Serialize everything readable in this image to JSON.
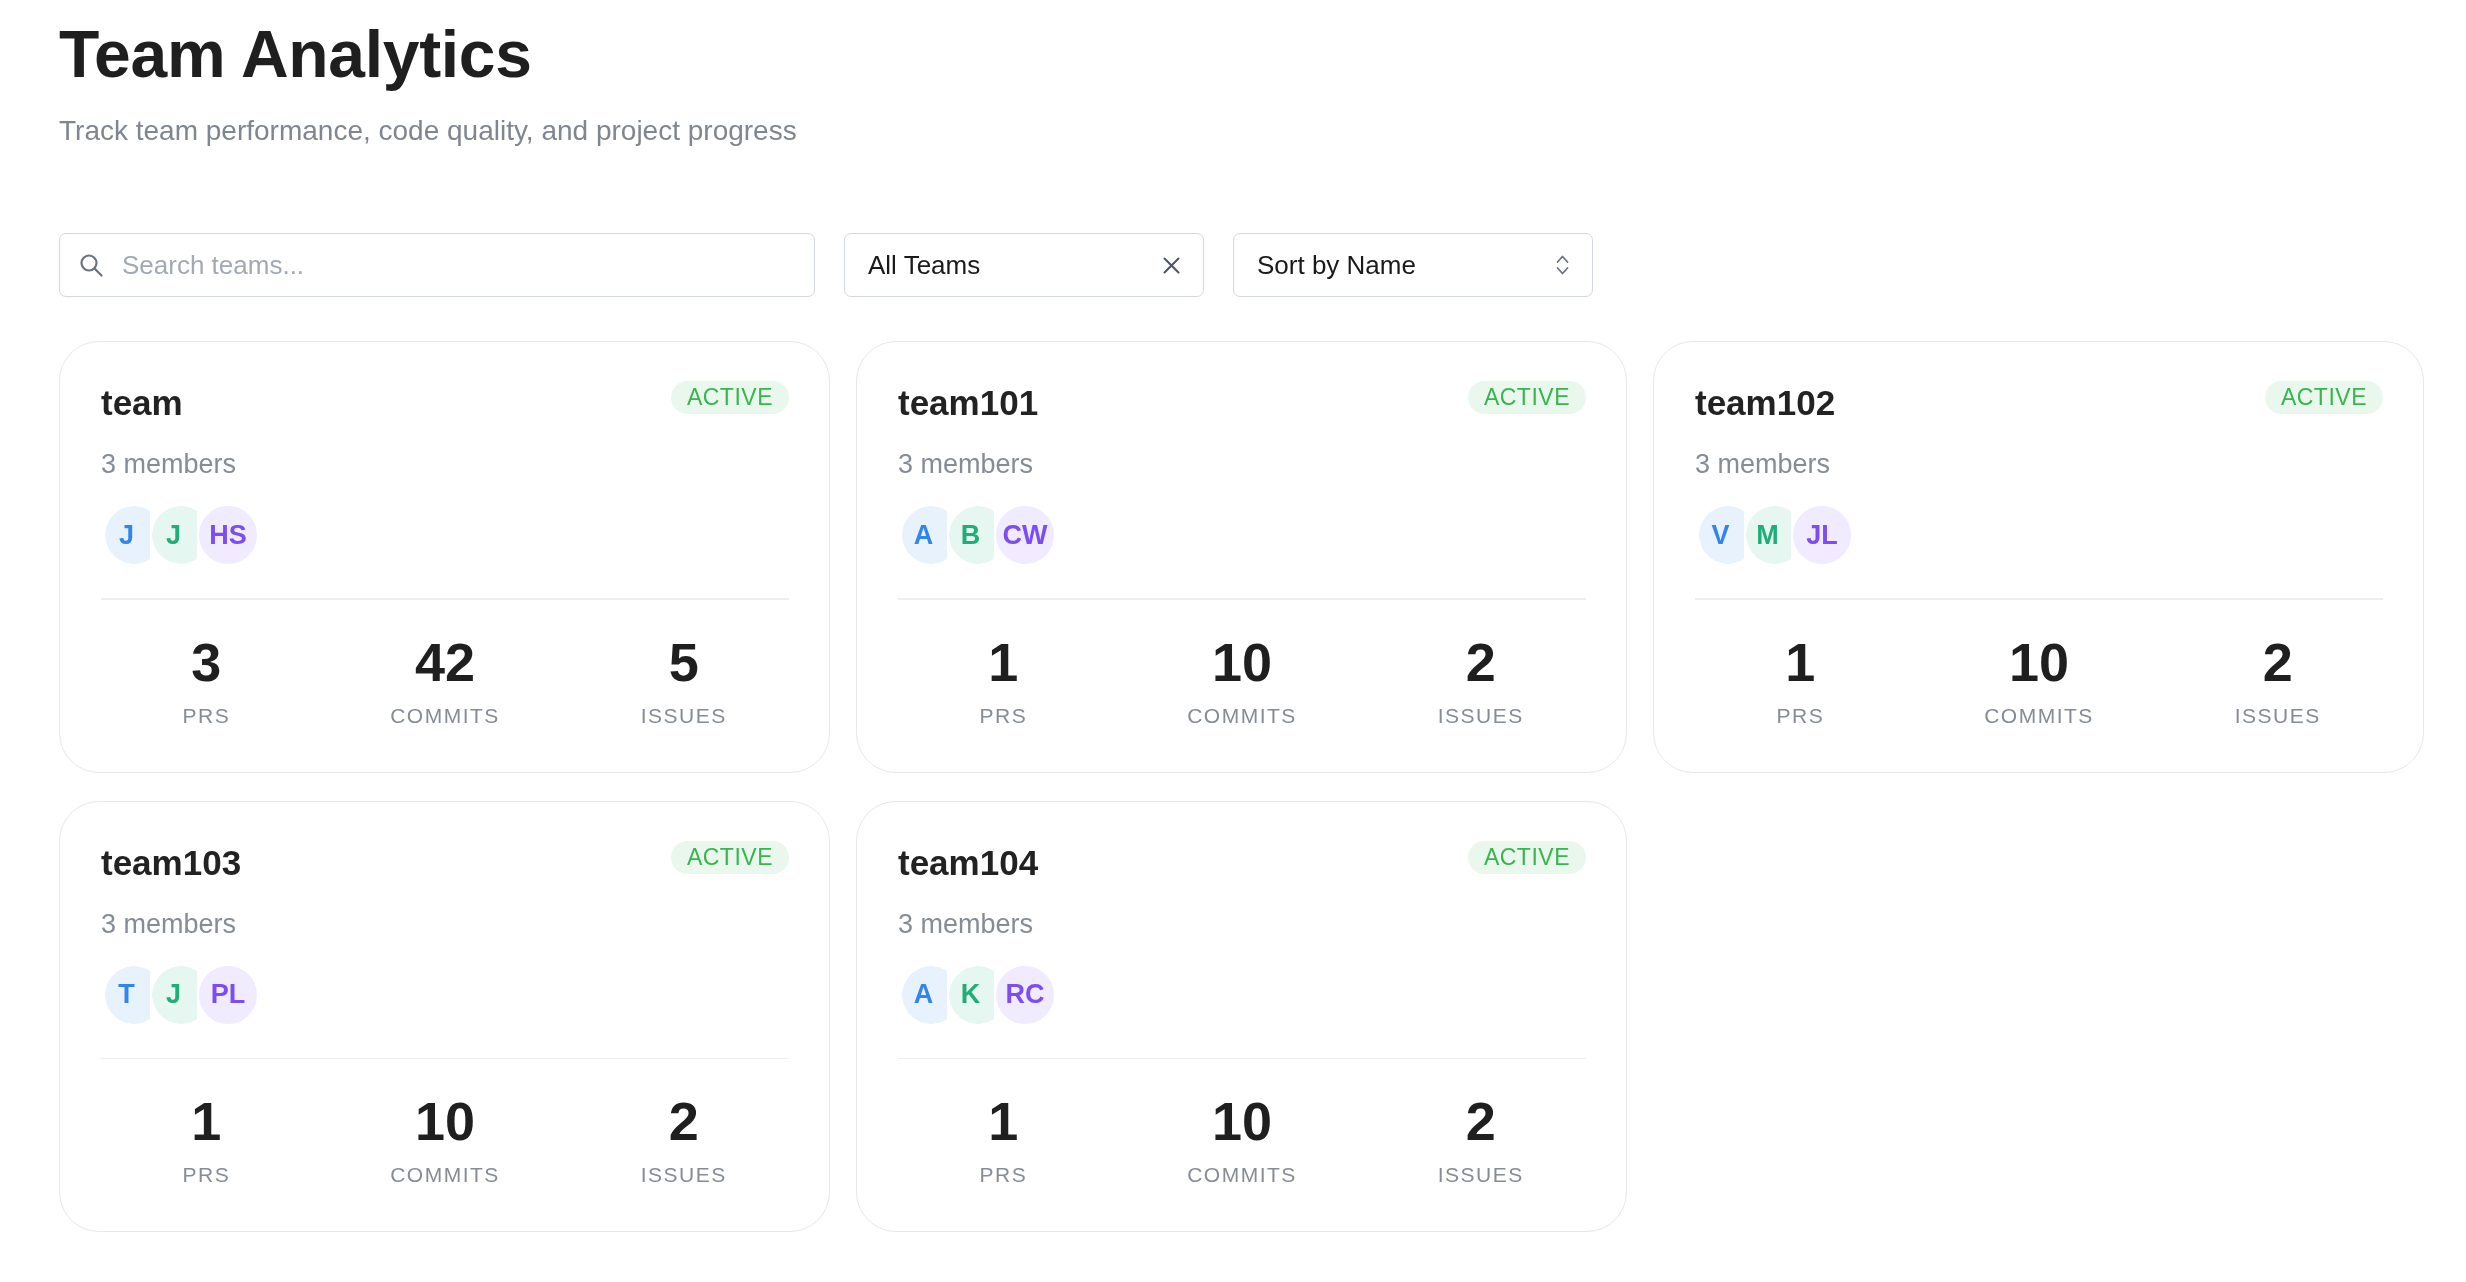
{
  "header": {
    "title": "Team Analytics",
    "subtitle": "Track team performance, code quality, and project progress"
  },
  "filters": {
    "search": {
      "placeholder": "Search teams..."
    },
    "team_filter": {
      "value": "All Teams"
    },
    "sort": {
      "value": "Sort by Name"
    }
  },
  "teams": [
    {
      "name": "team",
      "status": "ACTIVE",
      "members_label": "3 members",
      "members": [
        {
          "initials": "J",
          "color": "#2f86eb"
        },
        {
          "initials": "J",
          "color": "#1fae78"
        },
        {
          "initials": "HS",
          "color": "#7b4df2"
        }
      ],
      "stats": [
        {
          "value": "3",
          "label": "PRS"
        },
        {
          "value": "42",
          "label": "COMMITS"
        },
        {
          "value": "5",
          "label": "ISSUES"
        }
      ]
    },
    {
      "name": "team101",
      "status": "ACTIVE",
      "members_label": "3 members",
      "members": [
        {
          "initials": "A",
          "color": "#2f86eb"
        },
        {
          "initials": "B",
          "color": "#1fae78"
        },
        {
          "initials": "CW",
          "color": "#7b4df2"
        }
      ],
      "stats": [
        {
          "value": "1",
          "label": "PRS"
        },
        {
          "value": "10",
          "label": "COMMITS"
        },
        {
          "value": "2",
          "label": "ISSUES"
        }
      ]
    },
    {
      "name": "team102",
      "status": "ACTIVE",
      "members_label": "3 members",
      "members": [
        {
          "initials": "V",
          "color": "#2f86eb"
        },
        {
          "initials": "M",
          "color": "#1fae78"
        },
        {
          "initials": "JL",
          "color": "#7b4df2"
        }
      ],
      "stats": [
        {
          "value": "1",
          "label": "PRS"
        },
        {
          "value": "10",
          "label": "COMMITS"
        },
        {
          "value": "2",
          "label": "ISSUES"
        }
      ]
    },
    {
      "name": "team103",
      "status": "ACTIVE",
      "members_label": "3 members",
      "members": [
        {
          "initials": "T",
          "color": "#2f86eb"
        },
        {
          "initials": "J",
          "color": "#1fae78"
        },
        {
          "initials": "PL",
          "color": "#7b4df2"
        }
      ],
      "stats": [
        {
          "value": "1",
          "label": "PRS"
        },
        {
          "value": "10",
          "label": "COMMITS"
        },
        {
          "value": "2",
          "label": "ISSUES"
        }
      ]
    },
    {
      "name": "team104",
      "status": "ACTIVE",
      "members_label": "3 members",
      "members": [
        {
          "initials": "A",
          "color": "#2f86eb"
        },
        {
          "initials": "K",
          "color": "#1fae78"
        },
        {
          "initials": "RC",
          "color": "#7b4df2"
        }
      ],
      "stats": [
        {
          "value": "1",
          "label": "PRS"
        },
        {
          "value": "10",
          "label": "COMMITS"
        },
        {
          "value": "2",
          "label": "ISSUES"
        }
      ]
    }
  ]
}
